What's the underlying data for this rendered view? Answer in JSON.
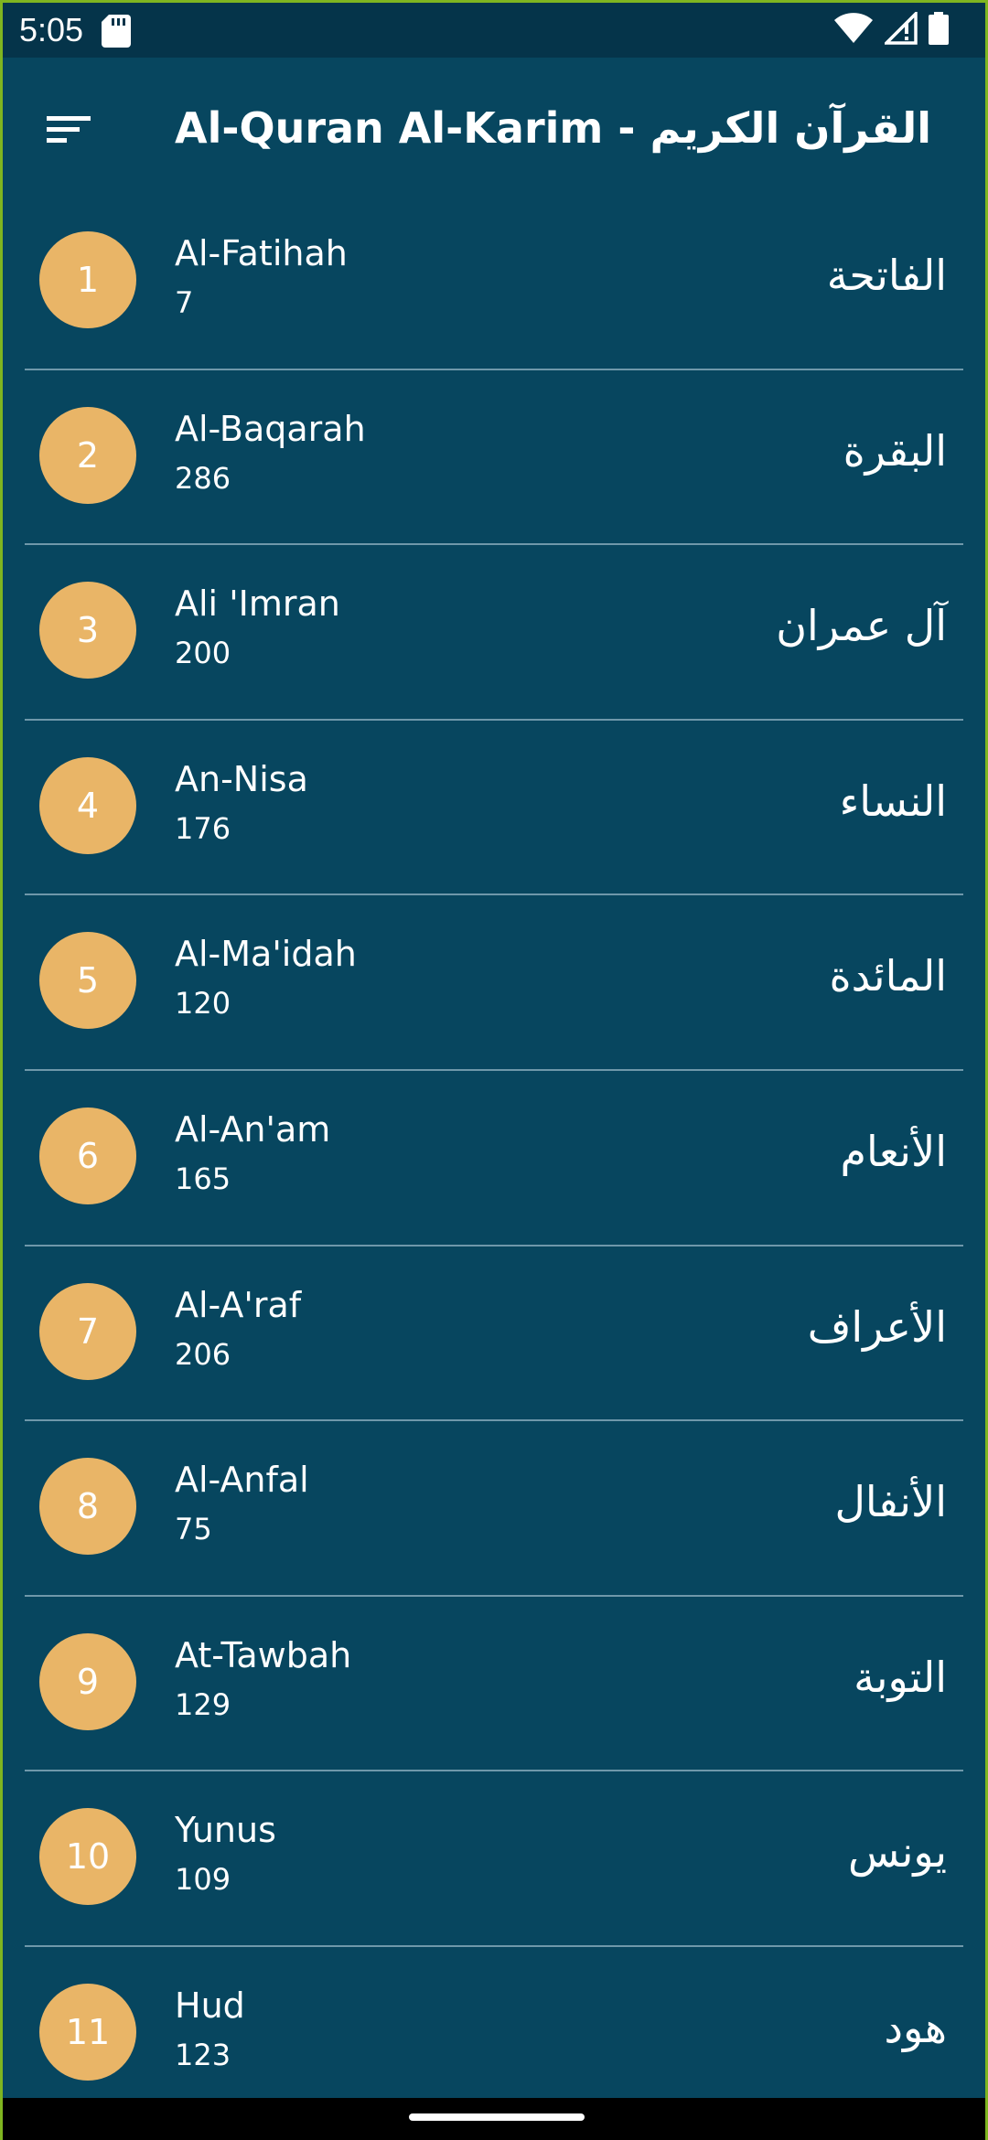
{
  "status_bar": {
    "time": "5:05",
    "icons": [
      "sd-card-icon",
      "wifi-icon",
      "no-signal-icon",
      "battery-icon"
    ]
  },
  "app_bar": {
    "menu_icon": "sort-menu-icon",
    "title": "Al-Quran Al-Karim - القرآن الكريم"
  },
  "surahs": [
    {
      "number": "1",
      "name": "Al-Fatihah",
      "verses": "7",
      "arabic": "الفاتحة"
    },
    {
      "number": "2",
      "name": "Al-Baqarah",
      "verses": "286",
      "arabic": "البقرة"
    },
    {
      "number": "3",
      "name": "Ali 'Imran",
      "verses": "200",
      "arabic": "آل عمران"
    },
    {
      "number": "4",
      "name": "An-Nisa",
      "verses": "176",
      "arabic": "النساء"
    },
    {
      "number": "5",
      "name": "Al-Ma'idah",
      "verses": "120",
      "arabic": "المائدة"
    },
    {
      "number": "6",
      "name": "Al-An'am",
      "verses": "165",
      "arabic": "الأنعام"
    },
    {
      "number": "7",
      "name": "Al-A'raf",
      "verses": "206",
      "arabic": "الأعراف"
    },
    {
      "number": "8",
      "name": "Al-Anfal",
      "verses": "75",
      "arabic": "الأنفال"
    },
    {
      "number": "9",
      "name": "At-Tawbah",
      "verses": "129",
      "arabic": "التوبة"
    },
    {
      "number": "10",
      "name": "Yunus",
      "verses": "109",
      "arabic": "يونس"
    },
    {
      "number": "11",
      "name": "Hud",
      "verses": "123",
      "arabic": "هود"
    }
  ],
  "colors": {
    "background": "#07465f",
    "status_bar": "#05344a",
    "badge": "#e9b567",
    "divider": "#6f98aa",
    "frame_border": "#7fb520"
  }
}
